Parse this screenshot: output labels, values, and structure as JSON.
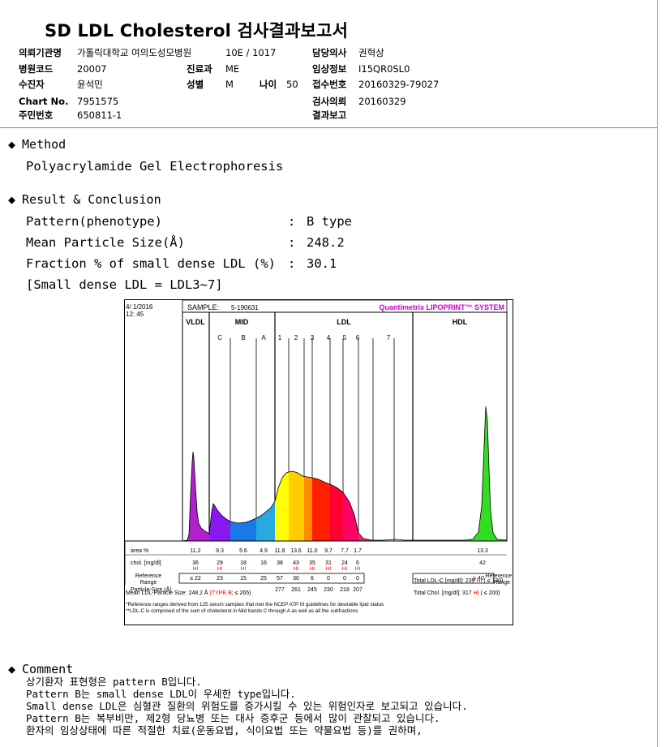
{
  "title": "SD LDL Cholesterol 검사결과보고서",
  "header": {
    "institution_label": "의뢰기관명",
    "institution": "가톨릭대학교 여의도성모병원",
    "ward_value": "10E / 1017",
    "doctor_label": "담당의사",
    "doctor": "권혁상",
    "hospital_code_label": "병원코드",
    "hospital_code": "20007",
    "dept_label": "진료과",
    "dept": "ME",
    "clinical_info_label": "임상정보",
    "clinical_info": "I15QR0SL0",
    "patient_label": "수진자",
    "patient": "윤석민",
    "sex_label": "성별",
    "sex": "M",
    "age_label": "나이",
    "age": "50",
    "receipt_label": "접수번호",
    "receipt": "20160329-79027",
    "chart_label": "Chart No.",
    "chart_no": "7951575",
    "request_date_label": "검사의뢰",
    "request_date": "20160329",
    "rrn_label": "주민번호",
    "rrn": "650811-1",
    "report_label": "결과보고",
    "report_date": ""
  },
  "method": {
    "heading": "Method",
    "text": "Polyacrylamide Gel Electrophoresis"
  },
  "result": {
    "heading": "Result & Conclusion",
    "rows": [
      {
        "label": "Pattern(phenotype)",
        "value": "B type"
      },
      {
        "label": "Mean Particle Size(Å)",
        "value": "248.2"
      },
      {
        "label": "Fraction % of small dense LDL (%)",
        "value": "30.1"
      }
    ],
    "note": "[Small dense LDL = LDL3~7]"
  },
  "chart_data": {
    "type": "area",
    "date": "4/ 1/2016",
    "time": "12: 45",
    "sample_label": "SAMPLE:",
    "sample": "5-190631",
    "brand": "Quantimetrix LIPOPRINT™ SYSTEM",
    "band_groups": [
      "VLDL",
      "MID",
      "LDL",
      "HDL"
    ],
    "bands": [
      "C",
      "B",
      "A",
      "1",
      "2",
      "3",
      "4",
      "5",
      "6",
      "7"
    ],
    "band_colors": {
      "VLDL": "#b01fd0",
      "C": "#8a18f0",
      "B": "#1a78e8",
      "A": "#2aa8e0",
      "1": "#ffff00",
      "2": "#ffcc00",
      "3": "#ff8c00",
      "4": "#ff2000",
      "5": "#ff0033",
      "6": "#ff0066",
      "7": "#e0306a",
      "HDL": "#33dd22"
    },
    "rows": {
      "area_label": "area %",
      "area": [
        "11.2",
        "9.3",
        "5.6",
        "4.9",
        "11.8",
        "13.6",
        "11.0",
        "9.7",
        "7.7",
        "1.7",
        "",
        "13.3"
      ],
      "chol_label": "chol. [mg/dl]",
      "chol": [
        "36",
        "29",
        "18",
        "16",
        "38",
        "43",
        "35",
        "31",
        "24",
        "6",
        "",
        "42"
      ],
      "hi": [
        "HI",
        "HI",
        "HI",
        "",
        "",
        "HI",
        "HI",
        "HI",
        "HI",
        "HI",
        "",
        ""
      ],
      "ref_label_1": "Reference",
      "ref_label_2": "Range",
      "ref": [
        "≤ 22",
        "23",
        "15",
        "25",
        "57",
        "30",
        "6",
        "0",
        "0",
        "0",
        "",
        "≥ 40"
      ],
      "size_label": "Particle-Size (Å)",
      "size": [
        "",
        "",
        "",
        "",
        "277",
        "261",
        "245",
        "230",
        "218",
        "207",
        "",
        ""
      ]
    },
    "mean_size_text": "Mean LDL-Particle Size:",
    "mean_size_value": "248.2 Å",
    "mean_size_type": "(TYPE B",
    "mean_size_ref": "; ≤ 265)",
    "total_ldl_label": "Total LDL-C [mg/dl]:",
    "total_ldl": "239",
    "total_ldl_flag": "HI",
    "total_ldl_ref": "( ≤ 130)",
    "total_chol_label": "Total Chol. [mg/dl]:",
    "total_chol": "317",
    "total_chol_flag": "HI",
    "total_chol_ref": "( ≤ 200)",
    "footnote1": "*Reference ranges derived from 125 serum samples that met the NCEP ATP III guidelines for desirable lipid status",
    "footnote2": "**LDL-C is comprised of the sum of cholesterol in Mid bands C through A as well as all the subfractions"
  },
  "comment": {
    "heading": "Comment",
    "lines": [
      "상기환자 표현형은 pattern B입니다.",
      "Pattern B는 small dense LDL이 우세한 type입니다.",
      "Small dense LDL은 심혈관 질환의 위험도를 증가시킬 수 있는 위험인자로 보고되고 있습니다.",
      "Pattern B는 복부비만, 제2형 당뇨병 또는 대사 증후군 등에서 많이 관찰되고 있습니다.",
      "환자의 임상상태에 따른 적절한 치료(운동요법, 식이요법 또는 약물요법 등)를 권하며,"
    ]
  }
}
